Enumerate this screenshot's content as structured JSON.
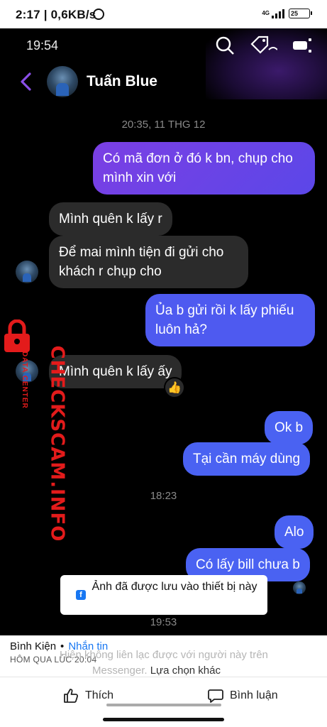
{
  "outer_status": {
    "time_net": "2:17 | 0,6KB/s",
    "network": "4G",
    "battery": "25"
  },
  "inner_status": {
    "time": "19:54"
  },
  "header": {
    "contact_name": "Tuấn Blue"
  },
  "conversation": {
    "timestamps": [
      "20:35, 11 THG 12",
      "18:23",
      "19:53"
    ],
    "messages": [
      {
        "from": "me",
        "text": "Có mã đơn ở đó k bn, chụp cho mình xin với"
      },
      {
        "from": "them",
        "text": "Mình quên k lấy r"
      },
      {
        "from": "them",
        "text": "Để mai mình tiện đi gửi cho khách r chụp cho"
      },
      {
        "from": "me",
        "text": "Ủa b gửi rồi k lấy phiếu luôn hả?"
      },
      {
        "from": "them",
        "text": "Mình quên k lấy ấy",
        "reaction": "👍"
      },
      {
        "from": "me",
        "text": "Ok b"
      },
      {
        "from": "me",
        "text": "Tại cần máy dùng"
      },
      {
        "from": "me",
        "text": "Alo"
      },
      {
        "from": "me",
        "text": "Có lấy bill chưa b"
      }
    ]
  },
  "watermark": {
    "brand": "CHECKSCAM.INFO",
    "sub": "DATA CENTER"
  },
  "toast": {
    "icon": "f",
    "message": "Ảnh đã được lưu vào thiết bị này"
  },
  "footer": {
    "commenter_name": "Bình Kiện",
    "commenter_link": "Nhắn tin",
    "commenter_time": "HÔM QUA LÚC 20:04",
    "overlay_line1": "Hiện không liên lạc được với người này trên",
    "overlay_line2": "Messenger.",
    "overlay_action": "Lựa chọn khác",
    "like_label": "Thích",
    "comment_label": "Bình luận"
  }
}
